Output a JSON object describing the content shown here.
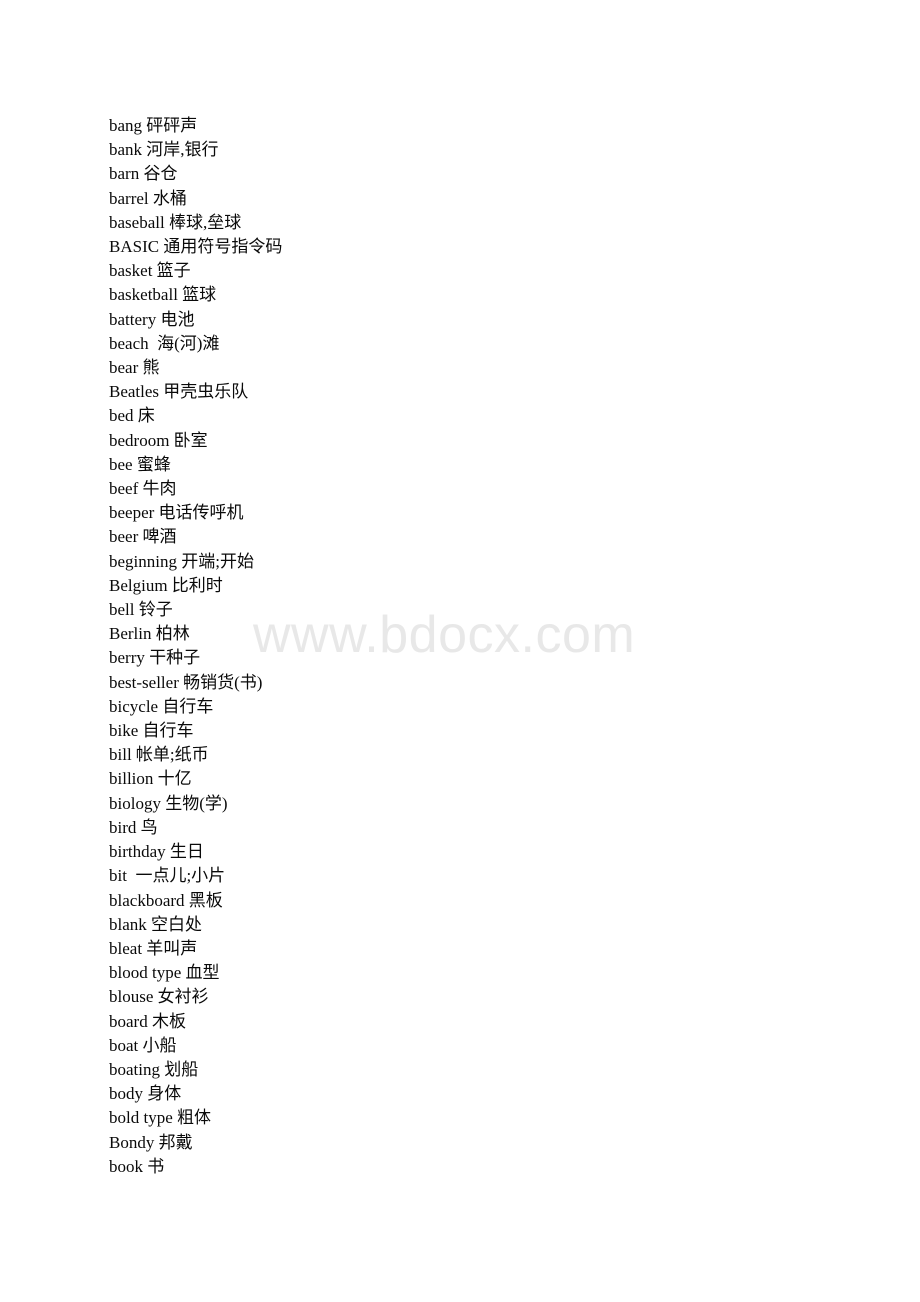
{
  "document": {
    "background_color": "#ffffff",
    "text_color": "#0a0a0a"
  },
  "watermark": {
    "text": "www.bdocx.com",
    "color": "#e8e8e8"
  },
  "entries": [
    {
      "term": "bang",
      "definition": "砰砰声",
      "line": "bang 砰砰声"
    },
    {
      "term": "bank",
      "definition": "河岸,银行",
      "line": "bank 河岸,银行"
    },
    {
      "term": "barn",
      "definition": "谷仓",
      "line": "barn 谷仓"
    },
    {
      "term": "barrel",
      "definition": "水桶",
      "line": "barrel 水桶"
    },
    {
      "term": "baseball",
      "definition": "棒球,垒球",
      "line": "baseball 棒球,垒球"
    },
    {
      "term": "BASIC",
      "definition": "通用符号指令码",
      "line": "BASIC 通用符号指令码"
    },
    {
      "term": "basket",
      "definition": "篮子",
      "line": "basket 篮子"
    },
    {
      "term": "basketball",
      "definition": "篮球",
      "line": "basketball 篮球"
    },
    {
      "term": "battery",
      "definition": "电池",
      "line": "battery 电池"
    },
    {
      "term": "beach",
      "definition": "海(河)滩",
      "line": "beach  海(河)滩"
    },
    {
      "term": "bear",
      "definition": "熊",
      "line": "bear 熊"
    },
    {
      "term": "Beatles",
      "definition": "甲壳虫乐队",
      "line": "Beatles 甲壳虫乐队"
    },
    {
      "term": "bed",
      "definition": "床",
      "line": "bed 床"
    },
    {
      "term": "bedroom",
      "definition": "卧室",
      "line": "bedroom 卧室"
    },
    {
      "term": "bee",
      "definition": "蜜蜂",
      "line": "bee 蜜蜂"
    },
    {
      "term": "beef",
      "definition": "牛肉",
      "line": "beef 牛肉"
    },
    {
      "term": "beeper",
      "definition": "电话传呼机",
      "line": "beeper 电话传呼机"
    },
    {
      "term": "beer",
      "definition": "啤酒",
      "line": "beer 啤酒"
    },
    {
      "term": "beginning",
      "definition": "开端;开始",
      "line": "beginning 开端;开始"
    },
    {
      "term": "Belgium",
      "definition": "比利时",
      "line": "Belgium 比利时"
    },
    {
      "term": "bell",
      "definition": "铃子",
      "line": "bell 铃子"
    },
    {
      "term": "Berlin",
      "definition": "柏林",
      "line": "Berlin 柏林"
    },
    {
      "term": "berry",
      "definition": "干种子",
      "line": "berry 干种子"
    },
    {
      "term": "best-seller",
      "definition": "畅销货(书)",
      "line": "best-seller 畅销货(书)"
    },
    {
      "term": "bicycle",
      "definition": "自行车",
      "line": "bicycle 自行车"
    },
    {
      "term": "bike",
      "definition": "自行车",
      "line": "bike 自行车"
    },
    {
      "term": "bill",
      "definition": "帐单;纸币",
      "line": "bill 帐单;纸币"
    },
    {
      "term": "billion",
      "definition": "十亿",
      "line": "billion 十亿"
    },
    {
      "term": "biology",
      "definition": "生物(学)",
      "line": "biology 生物(学)"
    },
    {
      "term": "bird",
      "definition": "鸟",
      "line": "bird 鸟"
    },
    {
      "term": "birthday",
      "definition": "生日",
      "line": "birthday 生日"
    },
    {
      "term": "bit",
      "definition": "一点儿;小片",
      "line": "bit  一点儿;小片"
    },
    {
      "term": "blackboard",
      "definition": "黑板",
      "line": "blackboard 黑板"
    },
    {
      "term": "blank",
      "definition": "空白处",
      "line": "blank 空白处"
    },
    {
      "term": "bleat",
      "definition": "羊叫声",
      "line": "bleat 羊叫声"
    },
    {
      "term": "blood type",
      "definition": "血型",
      "line": "blood type 血型"
    },
    {
      "term": "blouse",
      "definition": "女衬衫",
      "line": "blouse 女衬衫"
    },
    {
      "term": "board",
      "definition": "木板",
      "line": "board 木板"
    },
    {
      "term": "boat",
      "definition": "小船",
      "line": "boat 小船"
    },
    {
      "term": "boating",
      "definition": "划船",
      "line": "boating 划船"
    },
    {
      "term": "body",
      "definition": "身体",
      "line": "body 身体"
    },
    {
      "term": "bold type",
      "definition": "粗体",
      "line": "bold type 粗体"
    },
    {
      "term": "Bondy",
      "definition": "邦戴",
      "line": "Bondy 邦戴"
    },
    {
      "term": "book",
      "definition": "书",
      "line": "book 书"
    }
  ]
}
